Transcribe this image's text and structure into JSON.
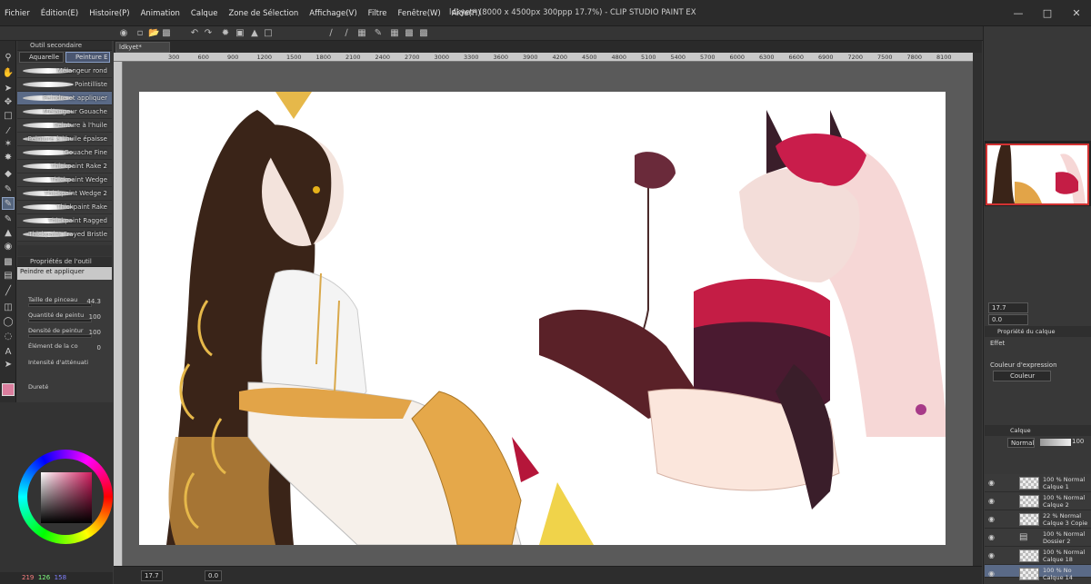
{
  "window": {
    "title": "ldkyet* (8000 x 4500px 300ppp 17.7%) - CLIP STUDIO PAINT EX",
    "controls": [
      "minimize-icon",
      "maximize-icon",
      "close-icon"
    ]
  },
  "menu": [
    "Fichier",
    "Édition(E)",
    "Histoire(P)",
    "Animation",
    "Calque",
    "Zone de Sélection",
    "Affichage(V)",
    "Filtre",
    "Fenêtre(W)",
    "Aide(H)"
  ],
  "sub_tool": {
    "header": "Outil secondaire",
    "tabs": [
      "Aquarelle",
      "Peinture E"
    ],
    "brushes": [
      "Mélangeur rond",
      "Pointilliste",
      "Peindre et appliquer",
      "Mélangeur Gouache",
      "Peinture à l'huile",
      "Peinture à l'huile épaisse",
      "Gouache Fine",
      "Thickpaint Rake 2",
      "Thickpaint Wedge",
      "Thickpaint Wedge 2",
      "Thickpaint Rake",
      "Thickpaint Ragged",
      "Thickpaint Frayed Bristle"
    ],
    "active_brush": "Peindre et appliquer"
  },
  "tool_property": {
    "header": "Propriétés de l'outil",
    "brush_name": "Peindre et appliquer",
    "rows": [
      {
        "label": "Taille de pinceau",
        "value": "44.3"
      },
      {
        "label": "Quantité de peintu",
        "value": "100"
      },
      {
        "label": "Densité de peintur",
        "value": "100"
      },
      {
        "label": "Élément de la co",
        "value": "0"
      },
      {
        "label": "Intensité d'atténuati",
        "value": ""
      },
      {
        "label": "Dureté",
        "value": ""
      }
    ]
  },
  "color": {
    "rgb_label": "219  126  158",
    "r": "219",
    "g": "126",
    "b": "158",
    "main_color": "#db7e9e"
  },
  "document": {
    "tab": "ldkyet*",
    "ruler_marks": [
      "300",
      "600",
      "900",
      "1200",
      "1500",
      "1800",
      "2100",
      "2400",
      "2700",
      "3000",
      "3300",
      "3600",
      "3900",
      "4200",
      "4500",
      "4800",
      "5100",
      "5400",
      "5700",
      "6000",
      "6300",
      "6600",
      "6900",
      "7200",
      "7500",
      "7800",
      "8100"
    ],
    "zoom": "17.7",
    "rotation": "0.0"
  },
  "right_panels": {
    "zoom": "17.7",
    "rotation": "0.0",
    "layer_property_header": "Propriété du calque",
    "effect_label": "Effet",
    "expression_color_label": "Couleur d'expression",
    "expression_color_value": "Couleur",
    "layer_tab": "Calque",
    "blend_mode": "Normal",
    "opacity": "100",
    "layers": [
      {
        "line1": "100 % Normal",
        "line2": "Calque 1",
        "type": "raster"
      },
      {
        "line1": "100 % Normal",
        "line2": "Calque 2",
        "type": "raster"
      },
      {
        "line1": "22 % Normal",
        "line2": "Calque 3 Copie",
        "type": "raster"
      },
      {
        "line1": "100 % Normal",
        "line2": "Dossier 2",
        "type": "folder"
      },
      {
        "line1": "100 % Normal",
        "line2": "Calque 18",
        "type": "raster"
      },
      {
        "line1": "100 % No",
        "line2": "Calque 14",
        "type": "raster"
      }
    ]
  }
}
